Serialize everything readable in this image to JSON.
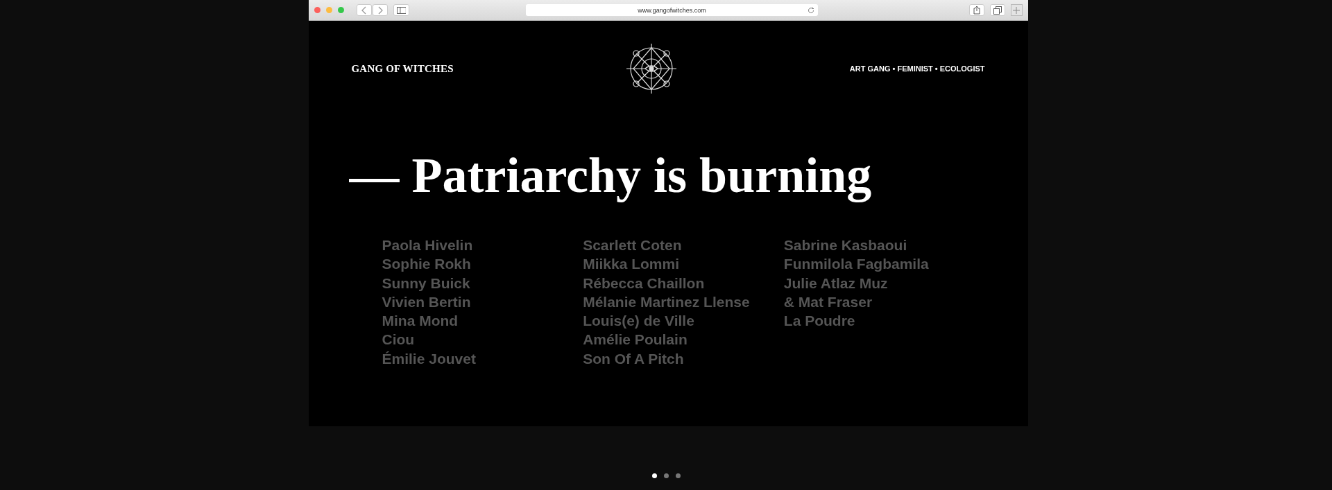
{
  "browser": {
    "url": "www.gangofwitches.com"
  },
  "header": {
    "brand": "GANG OF WITCHES",
    "tagline": "ART GANG • FEMINIST • ECOLOGIST"
  },
  "headline": "— Patriarchy is burning",
  "name_columns": [
    [
      "Paola Hivelin",
      "Sophie Rokh",
      "Sunny Buick",
      "Vivien Bertin",
      "Mina Mond",
      "Ciou",
      "Émilie Jouvet"
    ],
    [
      "Scarlett Coten",
      "Miikka Lommi",
      "Rébecca Chaillon",
      "Mélanie Martinez Llense",
      "Louis(e) de Ville",
      "Amélie Poulain",
      "Son Of A Pitch"
    ],
    [
      "Sabrine Kasbaoui",
      "Funmilola Fagbamila",
      "Julie Atlaz Muz",
      "& Mat Fraser",
      "La Poudre"
    ]
  ],
  "pager": [
    {
      "selected": true
    },
    {
      "selected": false
    },
    {
      "selected": false
    }
  ]
}
